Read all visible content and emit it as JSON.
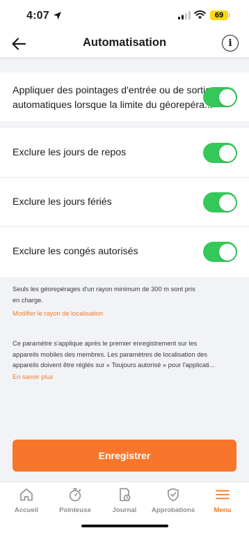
{
  "status_bar": {
    "time": "4:07",
    "battery": "69"
  },
  "header": {
    "title": "Automatisation"
  },
  "settings": {
    "geofence_auto": {
      "label_line1": "Appliquer des pointages d'entrée ou de sortie",
      "label_line2": "automatiques lorsque la limite du géorepéra...",
      "enabled": true
    },
    "exclusions": [
      {
        "label": "Exclure les jours de repos",
        "enabled": true
      },
      {
        "label": "Exclure les jours fériés",
        "enabled": true
      },
      {
        "label": "Exclure les congés autorisés",
        "enabled": true
      }
    ]
  },
  "notes": {
    "radius_line1": "Seuls les géorepérages d'un rayon minimum de 300 m sont pris",
    "radius_line2": "en charge.",
    "radius_link": "Modifier le rayon de localisation",
    "info_line1": "Ce paramètre s'applique après le premier enregistrement sur les",
    "info_line2": "appareils mobiles des membres. Les paramètres de localisation des",
    "info_line3": "appareils doivent être réglés sur « Toujours autorisé » pour l'applicati...",
    "info_link": "En savoir plus"
  },
  "save_button": {
    "label": "Enregistrer"
  },
  "tab_bar": {
    "tabs": [
      {
        "label": "Accueil",
        "icon": "home-icon"
      },
      {
        "label": "Pointeuse",
        "icon": "stopwatch-icon"
      },
      {
        "label": "Journal",
        "icon": "journal-icon"
      },
      {
        "label": "Approbations",
        "icon": "shield-check-icon"
      },
      {
        "label": "Menu",
        "icon": "menu-icon",
        "active": true
      }
    ]
  },
  "colors": {
    "accent": "#f47a24",
    "toggle_on": "#34c759",
    "background": "#f2f3f7"
  }
}
